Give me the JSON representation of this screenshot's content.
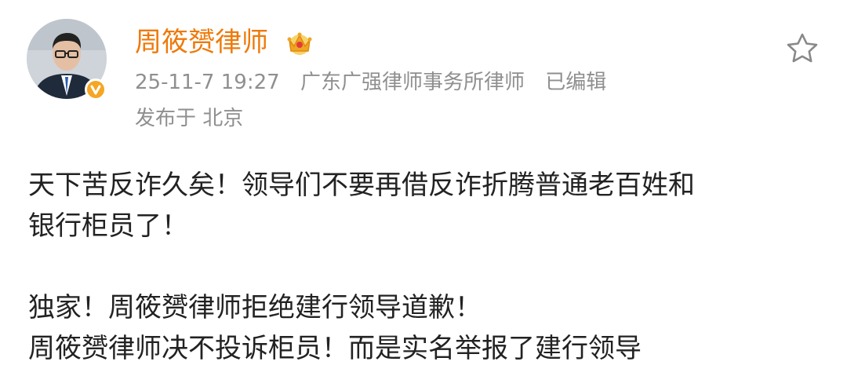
{
  "post": {
    "author_name": "周筱赟律师",
    "timestamp": "25-11-7 19:27",
    "verification": "广东广强律师事务所律师",
    "edited": "已编辑",
    "location": "发布于 北京",
    "paragraph1_line1": "天下苦反诈久矣！领导们不要再借反诈折腾普通老百姓和",
    "paragraph1_line2": "银行柜员了！",
    "paragraph2_line1": "独家！周筱赟律师拒绝建行领导道歉！",
    "paragraph2_line2": "周筱赟律师决不投诉柜员！而是实名举报了建行领导"
  },
  "icons": {
    "crown": "crown-icon",
    "verified": "verified-badge-icon",
    "star": "star-outline-icon"
  },
  "colors": {
    "name": "#ee7a0a",
    "meta": "#8f8f8f",
    "text": "#222222",
    "verified": "#f5a623"
  }
}
